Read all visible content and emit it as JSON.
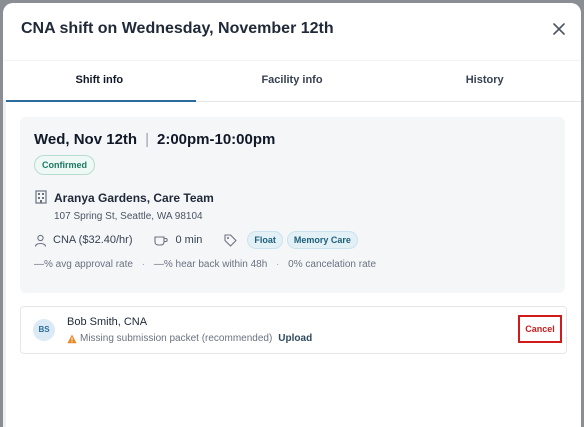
{
  "modal": {
    "title": "CNA shift on Wednesday, November 12th"
  },
  "tabs": [
    {
      "label": "Shift info",
      "active": true
    },
    {
      "label": "Facility info",
      "active": false
    },
    {
      "label": "History",
      "active": false
    }
  ],
  "shift": {
    "date": "Wed, Nov 12th",
    "time": "2:00pm-10:00pm",
    "status": "Confirmed",
    "facility_name": "Aranya Gardens, Care Team",
    "facility_address": "107 Spring St, Seattle, WA 98104",
    "role_pay": "CNA ($32.40/hr)",
    "break": "0 min",
    "tags": [
      "Float",
      "Memory Care"
    ],
    "stats": [
      "—% avg approval rate",
      "—% hear back within 48h",
      "0% cancelation rate"
    ]
  },
  "worker": {
    "initials": "BS",
    "name": "Bob Smith, CNA",
    "warning": "Missing submission packet (recommended)",
    "upload_label": "Upload",
    "cancel_label": "Cancel"
  },
  "colors": {
    "accent": "#2b6c9c",
    "confirmed": "#1c7a64",
    "cancel": "#c81e1e",
    "warning": "#e8892a"
  }
}
